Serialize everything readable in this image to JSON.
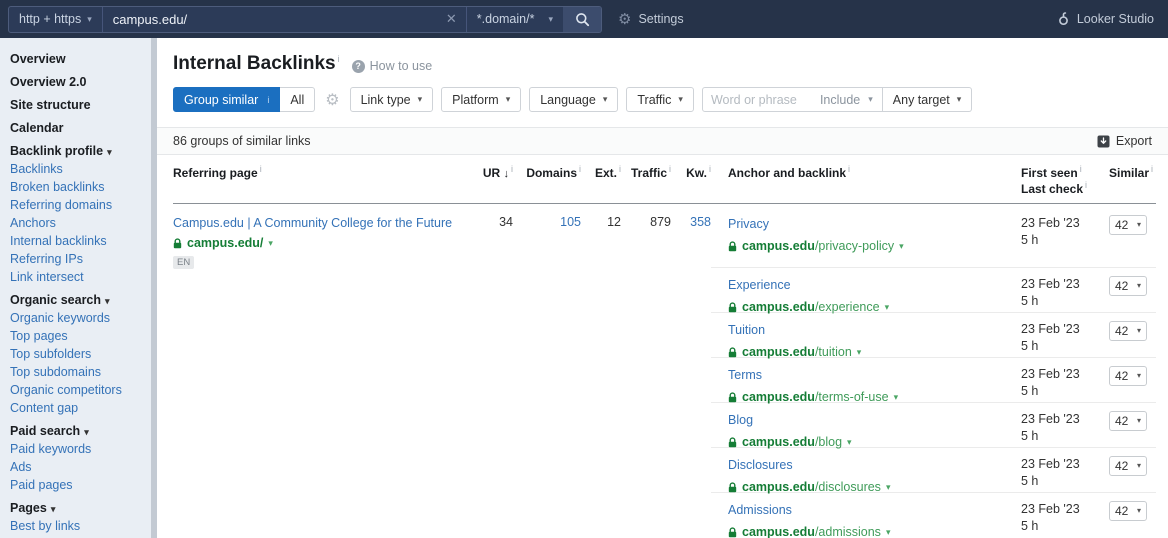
{
  "icons": {
    "caret": "▾",
    "info": "i",
    "sort_desc": "↓",
    "question": "?",
    "close": "✕",
    "gear": "⚙"
  },
  "topbar": {
    "mode": "http + https",
    "url_value": "campus.edu/",
    "scope": "*.domain/*",
    "settings_label": "Settings",
    "looker_label": "Looker Studio"
  },
  "sidebar": {
    "items": [
      {
        "label": "Overview",
        "kind": "toplink"
      },
      {
        "label": "Overview 2.0",
        "kind": "toplink"
      },
      {
        "label": "Site structure",
        "kind": "toplink"
      },
      {
        "label": "Calendar",
        "kind": "toplink"
      },
      {
        "label": "Backlink profile",
        "kind": "section"
      },
      {
        "label": "Backlinks",
        "kind": "link"
      },
      {
        "label": "Broken backlinks",
        "kind": "link"
      },
      {
        "label": "Referring domains",
        "kind": "link"
      },
      {
        "label": "Anchors",
        "kind": "link"
      },
      {
        "label": "Internal backlinks",
        "kind": "link"
      },
      {
        "label": "Referring IPs",
        "kind": "link"
      },
      {
        "label": "Link intersect",
        "kind": "link"
      },
      {
        "label": "Organic search",
        "kind": "section"
      },
      {
        "label": "Organic keywords",
        "kind": "link"
      },
      {
        "label": "Top pages",
        "kind": "link"
      },
      {
        "label": "Top subfolders",
        "kind": "link"
      },
      {
        "label": "Top subdomains",
        "kind": "link"
      },
      {
        "label": "Organic competitors",
        "kind": "link"
      },
      {
        "label": "Content gap",
        "kind": "link"
      },
      {
        "label": "Paid search",
        "kind": "section"
      },
      {
        "label": "Paid keywords",
        "kind": "link"
      },
      {
        "label": "Ads",
        "kind": "link"
      },
      {
        "label": "Paid pages",
        "kind": "link"
      },
      {
        "label": "Pages",
        "kind": "section"
      },
      {
        "label": "Best by links",
        "kind": "link"
      }
    ]
  },
  "main": {
    "title": "Internal Backlinks",
    "how_to_use": "How to use",
    "filters": {
      "group_similar": "Group similar",
      "all": "All",
      "link_type": "Link type",
      "platform": "Platform",
      "language": "Language",
      "traffic": "Traffic",
      "word_placeholder": "Word or phrase",
      "include": "Include",
      "any_target": "Any target"
    },
    "results_count": "86 groups of similar links",
    "export_label": "Export"
  },
  "table": {
    "headers": {
      "referring_page": "Referring page",
      "ur": "UR",
      "domains": "Domains",
      "ext": "Ext.",
      "traffic": "Traffic",
      "kw": "Kw.",
      "anchor": "Anchor and backlink",
      "first_seen": "First seen",
      "last_check": "Last check",
      "similar": "Similar"
    },
    "group": {
      "referring_title": "Campus.edu | A Community College for the Future",
      "referring_url": "campus.edu/",
      "language_badge": "EN",
      "ur": "34",
      "domains": "105",
      "ext": "12",
      "traffic": "879",
      "kw": "358",
      "rows": [
        {
          "anchor": "Privacy",
          "domain": "campus.edu",
          "path": "/privacy-policy",
          "first_seen": "23 Feb '23",
          "last_check": "5 h",
          "similar": "42"
        },
        {
          "anchor": "Experience",
          "domain": "campus.edu",
          "path": "/experience",
          "first_seen": "23 Feb '23",
          "last_check": "5 h",
          "similar": "42"
        },
        {
          "anchor": "Tuition",
          "domain": "campus.edu",
          "path": "/tuition",
          "first_seen": "23 Feb '23",
          "last_check": "5 h",
          "similar": "42"
        },
        {
          "anchor": "Terms",
          "domain": "campus.edu",
          "path": "/terms-of-use",
          "first_seen": "23 Feb '23",
          "last_check": "5 h",
          "similar": "42"
        },
        {
          "anchor": "Blog",
          "domain": "campus.edu",
          "path": "/blog",
          "first_seen": "23 Feb '23",
          "last_check": "5 h",
          "similar": "42"
        },
        {
          "anchor": "Disclosures",
          "domain": "campus.edu",
          "path": "/disclosures",
          "first_seen": "23 Feb '23",
          "last_check": "5 h",
          "similar": "42"
        },
        {
          "anchor": "Admissions",
          "domain": "campus.edu",
          "path": "/admissions",
          "first_seen": "23 Feb '23",
          "last_check": "5 h",
          "similar": "42"
        }
      ]
    }
  }
}
